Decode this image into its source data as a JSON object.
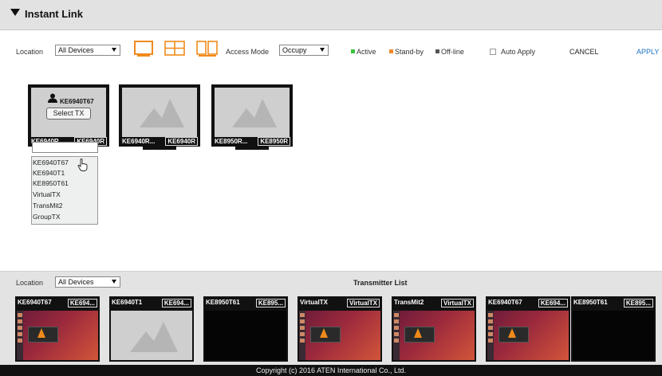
{
  "title_bar": {
    "title": "Instant Link"
  },
  "toolbar": {
    "location_label": "Location",
    "location_value": "All Devices",
    "access_mode_label": "Access Mode",
    "access_mode_value": "Occupy",
    "legend": {
      "active": "Active",
      "standby": "Stand-by",
      "offline": "Off-line",
      "colors": {
        "active": "#3cc23c",
        "standby": "#f08a2a",
        "offline": "#555555"
      }
    },
    "auto_apply_label": "Auto Apply",
    "cancel_label": "CANCEL",
    "apply_label": "APPLY"
  },
  "receivers": [
    {
      "label": "KE6940T67",
      "select_button": "Select TX",
      "bottom_label": "KE6940R",
      "badge": "KE6940R"
    },
    {
      "label": "KE6940R...",
      "badge": "KE6940R"
    },
    {
      "label": "KE8950R...",
      "badge": "KE8950R"
    }
  ],
  "dropdown": {
    "items": [
      "KE6940T67",
      "KE6940T1",
      "KE8950T61",
      "VirtualTX",
      "TransMit2",
      "GroupTX"
    ]
  },
  "bottom_panel": {
    "location_label": "Location",
    "location_value": "All Devices",
    "title": "Transmitter List"
  },
  "transmitters": [
    {
      "name": "KE6940T67",
      "badge": "KE694...",
      "thumb": "ubuntu"
    },
    {
      "name": "KE6940T1",
      "badge": "KE694...",
      "thumb": "placeholder"
    },
    {
      "name": "KE8950T61",
      "badge": "KE895...",
      "thumb": "black"
    },
    {
      "name": "VirtualTX",
      "badge": "VirtualTX",
      "thumb": "ubuntu"
    },
    {
      "name": "TransMit2",
      "badge": "VirtualTX",
      "thumb": "ubuntu"
    },
    {
      "name": "KE6940T67",
      "badge": "KE694...",
      "thumb": "ubuntu"
    },
    {
      "name": "KE8950T61",
      "badge": "KE895...",
      "thumb": "black"
    }
  ],
  "footer": {
    "copyright": "Copyright (c) 2016 ATEN International Co., Ltd."
  }
}
